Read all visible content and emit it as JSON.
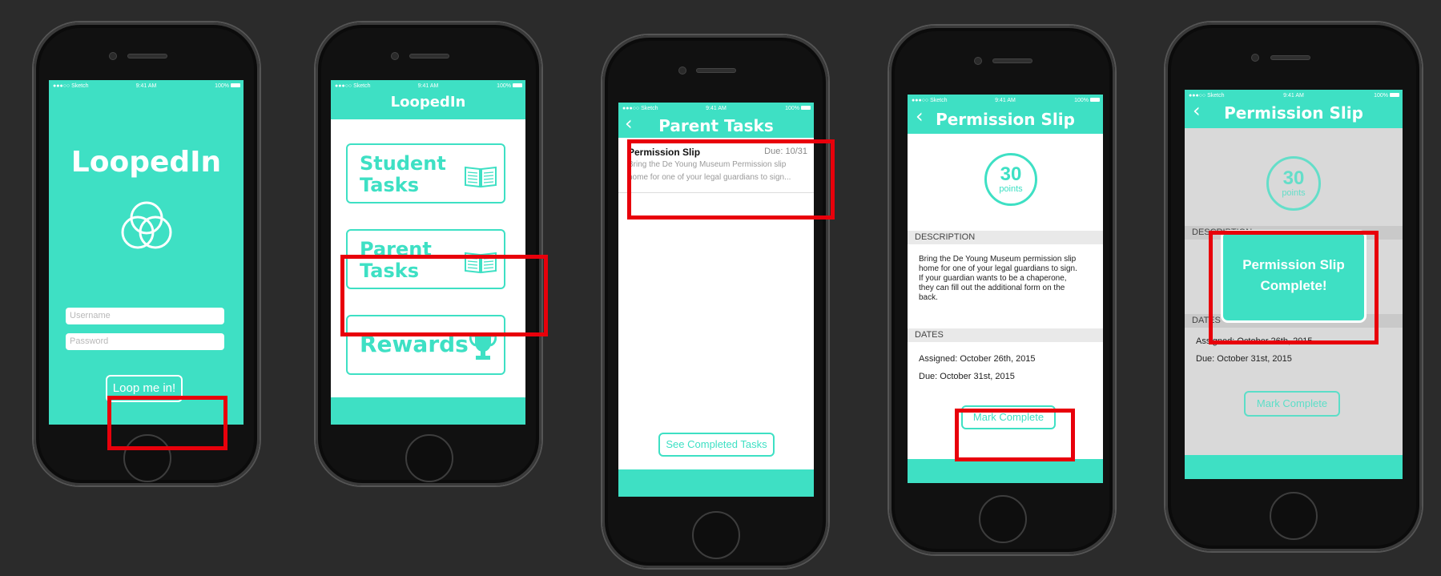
{
  "colors": {
    "accent": "#3ee0c4",
    "highlight": "#e8000b",
    "background": "#2b2b2b"
  },
  "status_bar": {
    "carrier": "●●●○○ Sketch",
    "time": "9:41 AM",
    "battery": "100%"
  },
  "login": {
    "app_title": "LoopedIn",
    "logo_icon": "three-circles-logo-icon",
    "username_placeholder": "Username",
    "password_placeholder": "Password",
    "login_button": "Loop me in!"
  },
  "home": {
    "nav_title": "LoopedIn",
    "student_tasks_label": [
      "Student",
      "Tasks"
    ],
    "parent_tasks_label": [
      "Parent",
      "Tasks"
    ],
    "rewards_label": "Rewards",
    "book_icon": "open-book-icon",
    "trophy_icon": "trophy-icon"
  },
  "parent_tasks": {
    "nav_title": "Parent Tasks",
    "back_icon": "chevron-left-icon",
    "task": {
      "title": "Permission Slip",
      "due": "Due: 10/31",
      "description_line1": "Bring the De Young Museum Permission slip",
      "description_line2": "home for one of your legal guardians to sign..."
    },
    "completed_button": "See Completed Tasks"
  },
  "permission_slip": {
    "nav_title": "Permission Slip",
    "points_value": "30",
    "points_label": "points",
    "description_header": "DESCRIPTION",
    "description_lines": [
      "Bring the De Young Museum permission slip",
      "home for one of your legal guardians to sign.",
      "If your guardian wants to be a chaperone,",
      "they can fill out the additional form on the",
      "back."
    ],
    "dates_header": "DATES",
    "assigned": "Assigned: October 26th, 2015",
    "due": "Due: October 31st, 2015",
    "mark_complete_button": "Mark Complete"
  },
  "permission_slip_complete": {
    "nav_title": "Permission Slip",
    "points_value": "30",
    "points_label": "points",
    "description_header": "DESCRIPTION",
    "dates_header": "DATES",
    "assigned": "Assigned: October 26th, 2015",
    "due": "Due: October 31st, 2015",
    "mark_complete_button": "Mark Complete",
    "modal_line1": "Permission Slip",
    "modal_line2": "Complete!"
  }
}
